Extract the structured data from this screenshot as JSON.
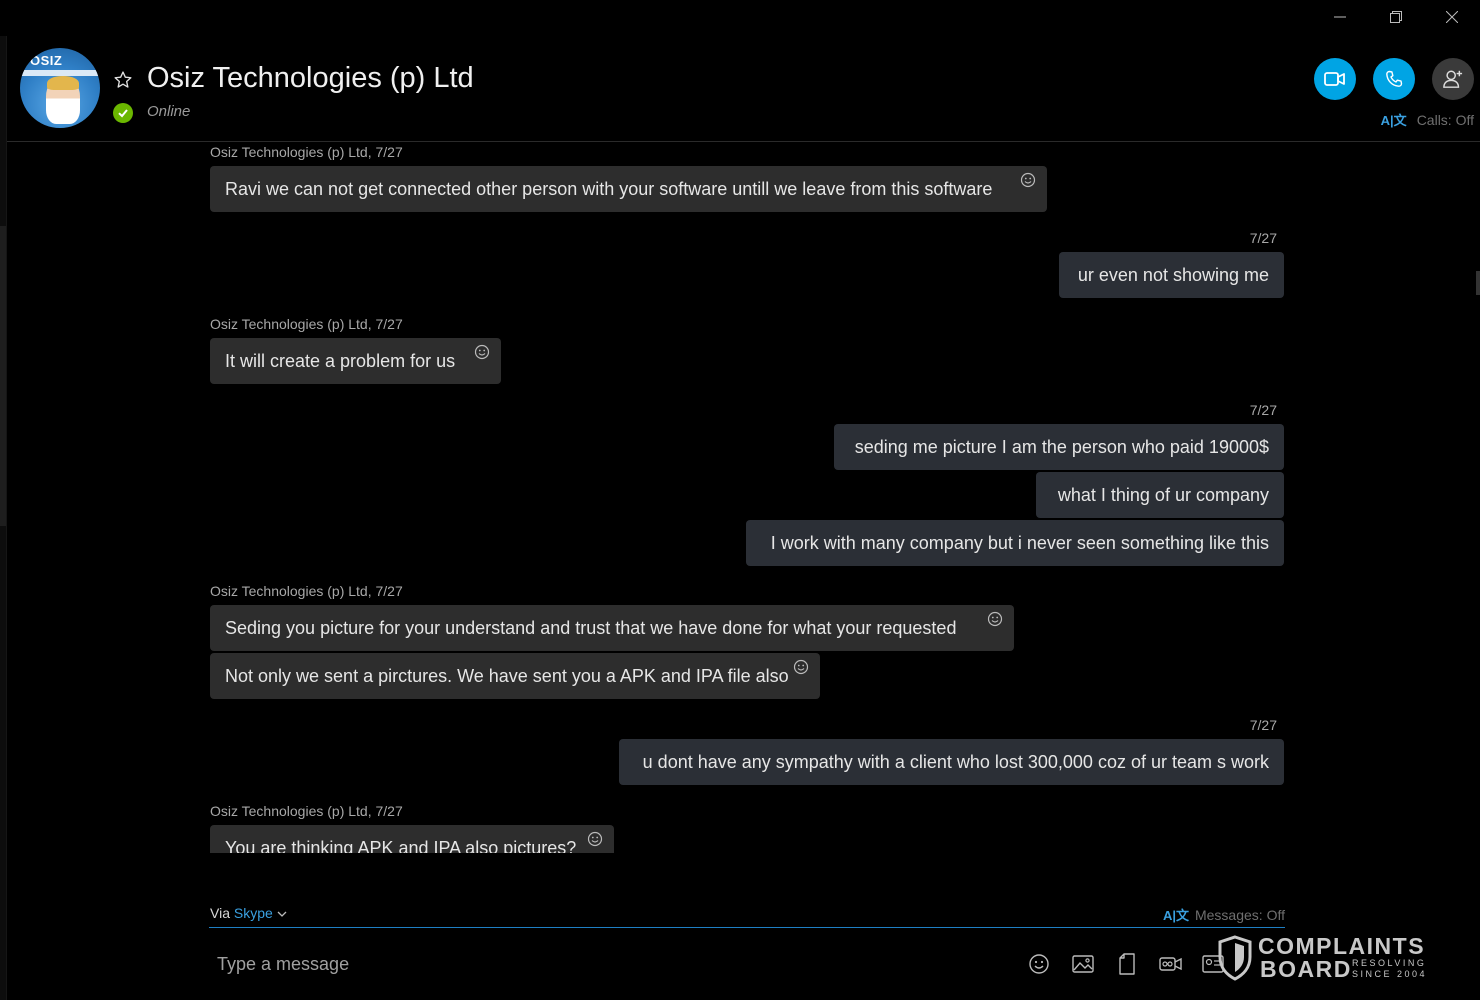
{
  "window": {
    "minimize_icon": "minimize-icon",
    "restore_icon": "restore-icon",
    "close_icon": "close-icon"
  },
  "header": {
    "avatar_logo_text": "OSIZ",
    "contact_name": "Osiz Technologies (p) Ltd",
    "status": "Online",
    "favorite_icon": "star-outline-icon",
    "buttons": [
      "video-call",
      "audio-call",
      "add-people"
    ],
    "calls_translate": "Calls: Off"
  },
  "messages": [
    {
      "meta": "Osiz Technologies (p) Ltd, 7/27",
      "text": "Ravi we can not get connected other person with your software untill we leave from this software"
    },
    {
      "meta": "7/27",
      "text": "ur even not showing me"
    },
    {
      "meta": "Osiz Technologies (p) Ltd, 7/27",
      "text": "It will create a problem for us"
    },
    {
      "meta": "7/27",
      "text": "seding me picture I am the person who paid 19000$"
    },
    {
      "text": "what I thing of ur company"
    },
    {
      "text": "I work with many company but i never seen something like this"
    },
    {
      "meta": "Osiz Technologies (p) Ltd, 7/27",
      "text": "Seding you picture for your understand and trust that we have done for what your requested"
    },
    {
      "text": "Not only we sent a pirctures. We have sent you a APK and IPA file also"
    },
    {
      "meta": "7/27",
      "text": "u dont have any sympathy with a client who lost 300,000 coz of ur team s work"
    },
    {
      "meta": "Osiz Technologies (p) Ltd, 7/27",
      "text": "You are thinking APK and IPA also pictures?"
    }
  ],
  "compose": {
    "via_label": "Via",
    "via_service": "Skype",
    "messages_translate": "Messages: Off",
    "placeholder": "Type a message",
    "icons": [
      "emoji-icon",
      "image-icon",
      "file-icon",
      "video-message-icon",
      "contact-card-icon"
    ]
  },
  "watermark": {
    "line1": "COMPLAINTS",
    "line2": "BOARD",
    "tag1": "RESOLVING",
    "tag2": "SINCE 2004"
  },
  "colors": {
    "background": "#000000",
    "accent": "#00a4e4",
    "online": "#6bb700",
    "bubble_in": "#2d2d2d",
    "bubble_out": "#2b2f36"
  }
}
